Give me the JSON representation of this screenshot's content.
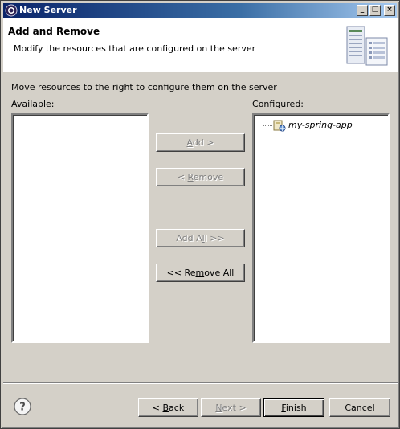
{
  "window": {
    "title": "New Server",
    "controls": {
      "minimize": "_",
      "maximize": "□",
      "close": "×"
    }
  },
  "banner": {
    "heading": "Add and Remove",
    "description": "Modify the resources that are configured on the server",
    "art_icon": "server-icon"
  },
  "instructions": "Move resources to the right to configure them on the server",
  "available": {
    "label_first": "A",
    "label_rest": "vailable:",
    "items": []
  },
  "configured": {
    "label_first": "C",
    "label_rest": "onfigured:",
    "items": [
      {
        "label": "my-spring-app",
        "icon": "web-project-icon"
      }
    ]
  },
  "actions": {
    "add": {
      "pre": "",
      "mn": "A",
      "post": "dd >",
      "enabled": false
    },
    "remove": {
      "pre": "< ",
      "mn": "R",
      "post": "emove",
      "enabled": false
    },
    "add_all": {
      "pre": "Add A",
      "mn": "l",
      "post": "l >>",
      "enabled": false
    },
    "remove_all": {
      "pre": "<< Re",
      "mn": "m",
      "post": "ove All",
      "enabled": true
    }
  },
  "footer": {
    "help_icon": "help-icon",
    "back": {
      "pre": "< ",
      "mn": "B",
      "post": "ack",
      "enabled": true
    },
    "next": {
      "pre": "",
      "mn": "N",
      "post": "ext >",
      "enabled": false
    },
    "finish": {
      "pre": "",
      "mn": "F",
      "post": "inish",
      "enabled": true
    },
    "cancel": {
      "label": "Cancel",
      "enabled": true
    }
  }
}
